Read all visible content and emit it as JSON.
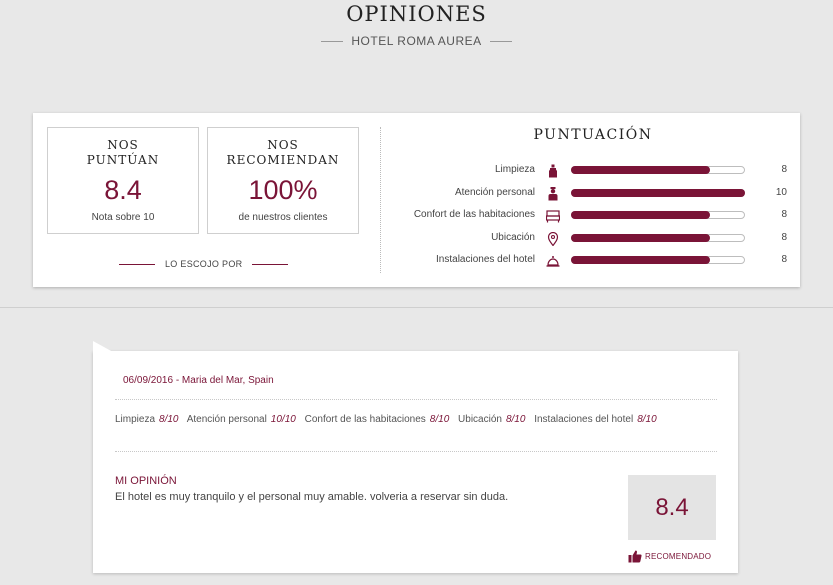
{
  "header": {
    "title": "OPINIONES",
    "hotel_name": "HOTEL ROMA AUREA"
  },
  "summary": {
    "rating": {
      "title_line1": "NOS",
      "title_line2": "PUNTÚAN",
      "value": "8.4",
      "caption": "Nota sobre 10"
    },
    "recommend": {
      "title_line1": "NOS",
      "title_line2": "RECOMIENDAN",
      "value": "100%",
      "caption": "de nuestros clientes"
    },
    "escojo_label": "LO ESCOJO POR"
  },
  "scores": {
    "title": "PUNTUACIÓN",
    "max": 10,
    "categories": [
      {
        "label": "Limpieza",
        "icon": "cleaning-bottle-icon",
        "score": 8,
        "score_text": "8"
      },
      {
        "label": "Atención personal",
        "icon": "staff-person-icon",
        "score": 10,
        "score_text": "10"
      },
      {
        "label": "Confort de las habitaciones",
        "icon": "bed-icon",
        "score": 8,
        "score_text": "8"
      },
      {
        "label": "Ubicación",
        "icon": "location-pin-icon",
        "score": 8,
        "score_text": "8"
      },
      {
        "label": "Instalaciones del hotel",
        "icon": "service-bell-icon",
        "score": 8,
        "score_text": "8"
      }
    ]
  },
  "review": {
    "meta": "06/09/2016 - Maria del Mar, Spain",
    "category_scores": [
      {
        "label": "Limpieza",
        "score": "8/10"
      },
      {
        "label": "Atención personal",
        "score": "10/10"
      },
      {
        "label": "Confort de las habitaciones",
        "score": "8/10"
      },
      {
        "label": "Ubicación",
        "score": "8/10"
      },
      {
        "label": "Instalaciones del hotel",
        "score": "8/10"
      }
    ],
    "opinion_title": "MI OPINIÓN",
    "opinion_text": "El hotel es muy tranquilo y el personal muy amable. volveria a reservar sin duda.",
    "score": "8.4",
    "recommended_label": "RECOMENDADO"
  },
  "colors": {
    "accent": "#7a1437",
    "background": "#e8e8e8"
  }
}
